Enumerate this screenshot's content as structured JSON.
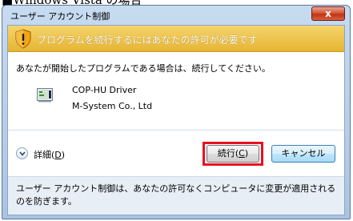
{
  "page_caption": "■Windows Vista の場合",
  "window": {
    "title": "ユーザー アカウント制御",
    "close_glyph": "x"
  },
  "banner": {
    "text": "プログラムを続行するにはあなたの許可が必要です",
    "icon": "shield-warning-icon"
  },
  "prompt": "あなたが開始したプログラムである場合は、続行してください。",
  "program": {
    "icon": "program-icon",
    "name": "COP-HU Driver",
    "publisher": "M-System Co., Ltd"
  },
  "details": {
    "label_prefix": "詳細(",
    "accel": "D",
    "label_suffix": ")"
  },
  "buttons": {
    "continue_prefix": "続行(",
    "continue_accel": "C",
    "continue_suffix": ")",
    "cancel": "キャンセル"
  },
  "footer": {
    "text": "ユーザー アカウント制御は、あなたの許可なくコンピュータに変更が適用されるのを防ぎます。"
  },
  "colors": {
    "highlight": "#e8101f",
    "banner": "#e6b533"
  }
}
